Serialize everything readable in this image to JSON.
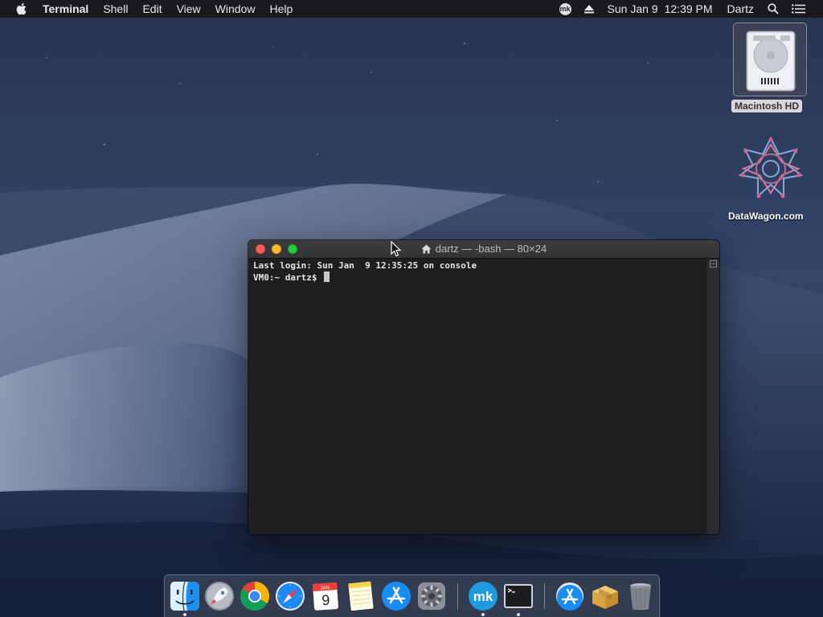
{
  "menubar": {
    "app_name": "Terminal",
    "menus": [
      "Shell",
      "Edit",
      "View",
      "Window",
      "Help"
    ],
    "status_badge": "mk",
    "date": "Sun Jan 9",
    "time": "12:39 PM",
    "user": "Dartz"
  },
  "desktop": {
    "icons": [
      {
        "label": "Macintosh HD",
        "icon": "hard-drive-icon",
        "selected": true
      },
      {
        "label": "DataWagon.com",
        "icon": "datawagon-icon",
        "selected": false
      }
    ]
  },
  "terminal": {
    "title": "dartz — -bash — 80×24",
    "lines": [
      "Last login: Sun Jan  9 12:35:25 on console",
      "VM0:~ dartz$ "
    ]
  },
  "dock": {
    "calendar_month": "JAN",
    "calendar_day": "9",
    "apps": [
      {
        "name": "finder-icon",
        "running": true
      },
      {
        "name": "launchpad-icon",
        "running": false
      },
      {
        "name": "chrome-icon",
        "running": false
      },
      {
        "name": "safari-icon",
        "running": false
      },
      {
        "name": "calendar-icon",
        "running": false
      },
      {
        "name": "notes-icon",
        "running": false
      },
      {
        "name": "app-store-icon",
        "running": false
      },
      {
        "name": "system-preferences-icon",
        "running": false
      },
      {
        "name": "mk-app-icon",
        "running": true
      },
      {
        "name": "terminal-icon",
        "running": true
      },
      {
        "name": "app-store-downloads-icon",
        "running": false
      },
      {
        "name": "package-installer-icon",
        "running": false
      },
      {
        "name": "trash-icon",
        "running": false
      }
    ]
  }
}
